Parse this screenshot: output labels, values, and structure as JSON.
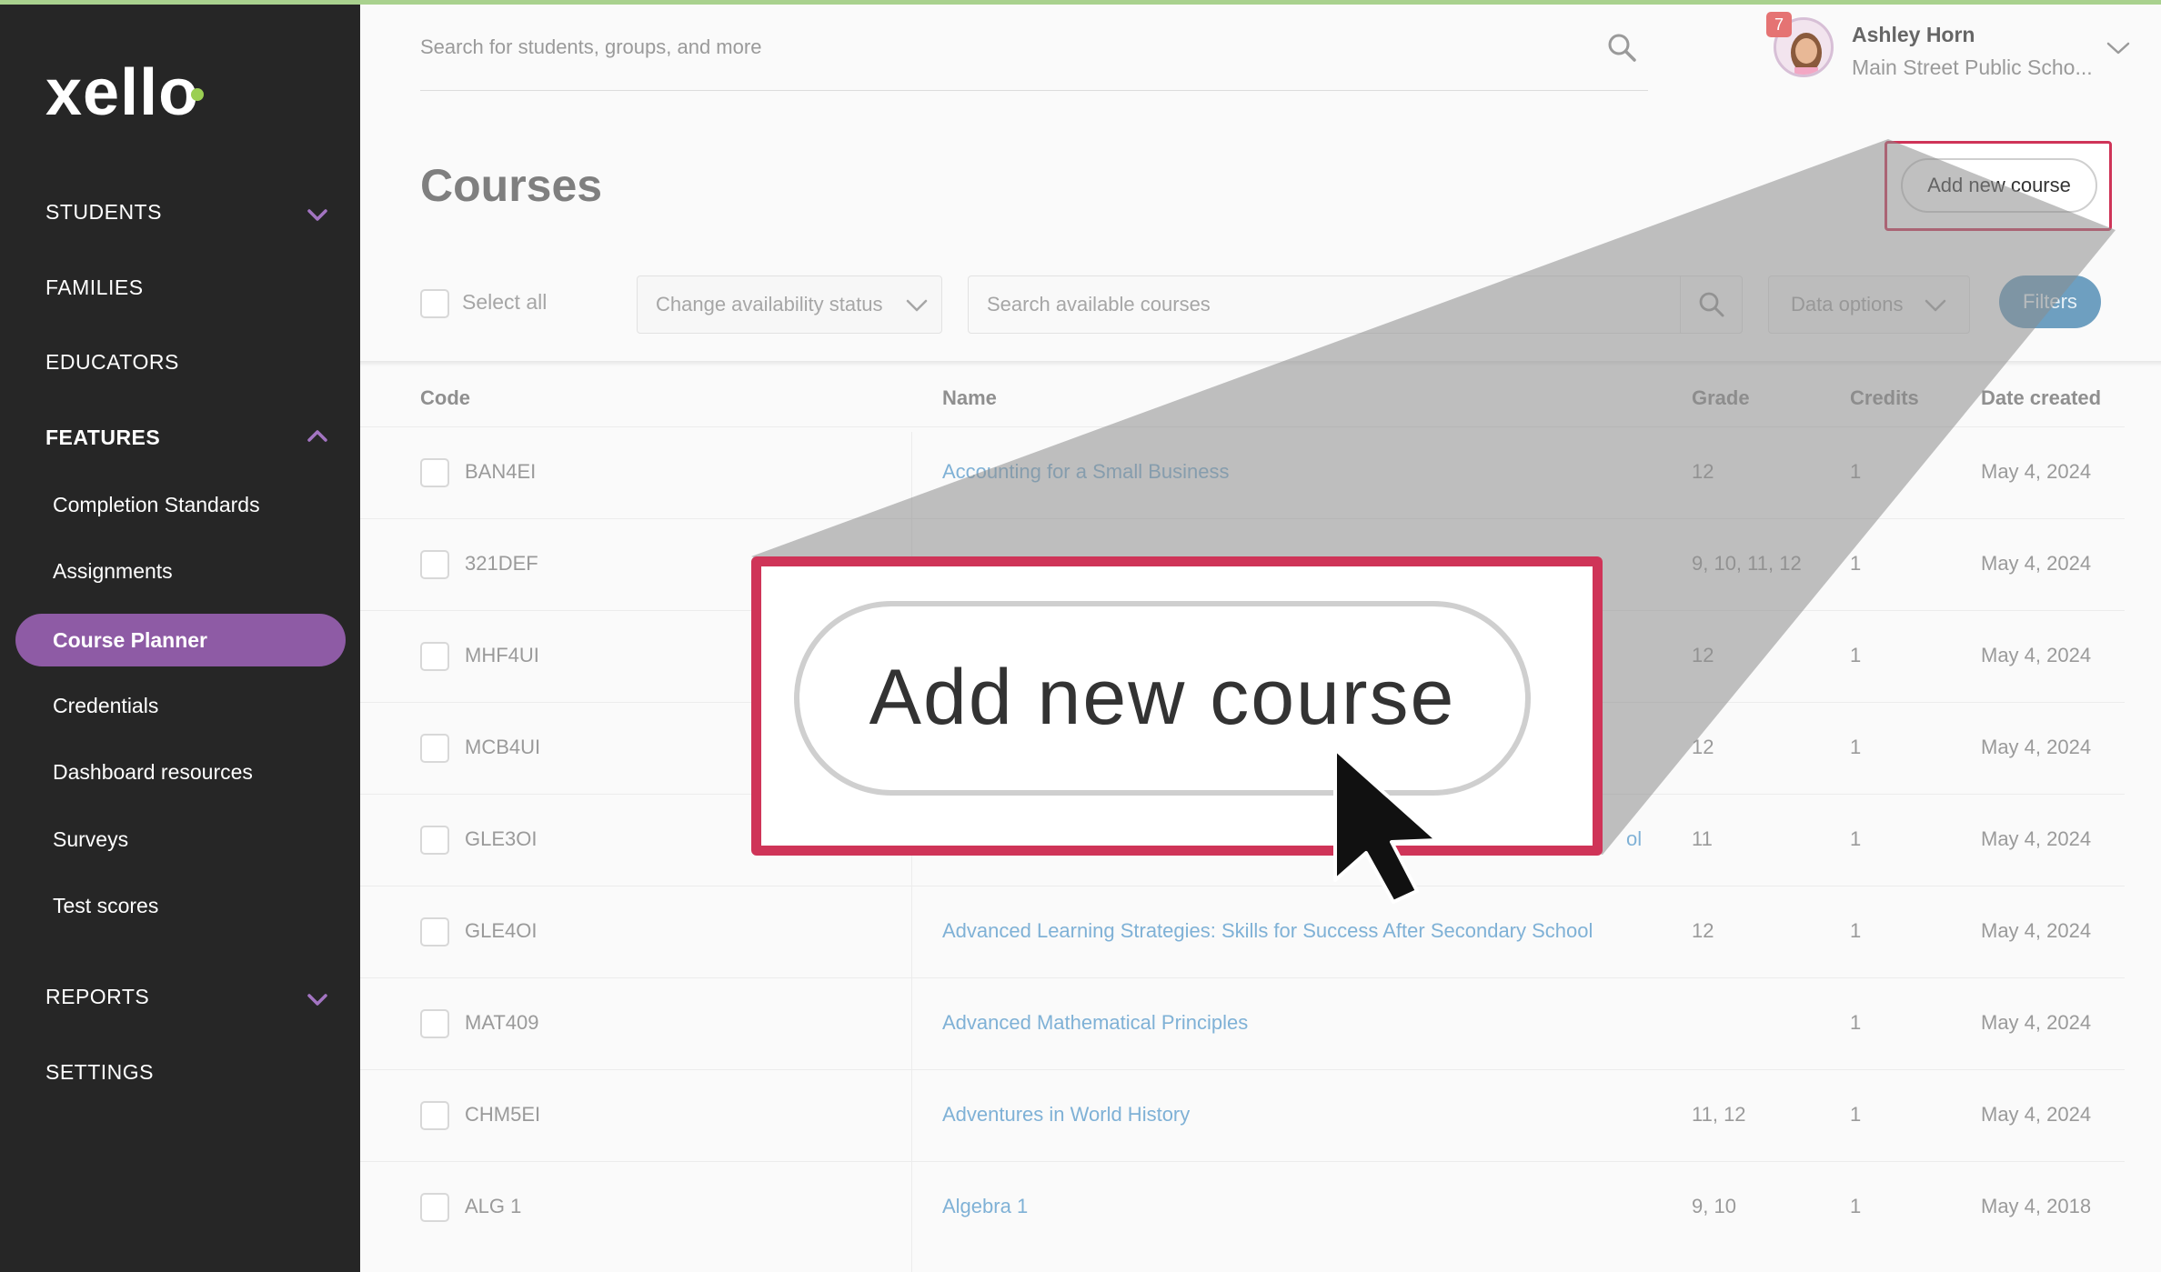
{
  "brand": {
    "logo_text": "xello",
    "accent": "#8e5ba5",
    "highlight": "#cf3458",
    "logo_dot": "#9bcf53"
  },
  "sidebar": {
    "students": "STUDENTS",
    "families": "FAMILIES",
    "educators": "EDUCATORS",
    "features": "FEATURES",
    "feature_items": [
      "Completion Standards",
      "Assignments",
      "Course Planner",
      "Credentials",
      "Dashboard resources",
      "Surveys",
      "Test scores"
    ],
    "active_item": "Course Planner",
    "reports": "REPORTS",
    "settings": "SETTINGS"
  },
  "header": {
    "search_placeholder": "Search for students, groups, and more",
    "notification_count": "7",
    "user_name": "Ashley Horn",
    "user_school": "Main Street Public Scho..."
  },
  "page": {
    "title": "Courses",
    "add_button": "Add new course"
  },
  "toolbar": {
    "select_all": "Select all",
    "availability": "Change availability status",
    "search_placeholder": "Search available courses",
    "data_options": "Data options",
    "filters": "Filters"
  },
  "table": {
    "headers": {
      "code": "Code",
      "name": "Name",
      "grade": "Grade",
      "credits": "Credits",
      "date": "Date created"
    },
    "rows": [
      {
        "code": "BAN4EI",
        "name": "Accounting for a Small Business",
        "grade": "12",
        "credits": "1",
        "date": "May 4, 2024"
      },
      {
        "code": "321DEF",
        "name": "",
        "grade": "9, 10, 11, 12",
        "credits": "1",
        "date": "May 4, 2024"
      },
      {
        "code": "MHF4UI",
        "name": "",
        "grade": "12",
        "credits": "1",
        "date": "May 4, 2024"
      },
      {
        "code": "MCB4UI",
        "name": "",
        "grade": "12",
        "credits": "1",
        "date": "May 4, 2024"
      },
      {
        "code": "GLE3OI",
        "name": "ol",
        "grade": "11",
        "credits": "1",
        "date": "May 4, 2024"
      },
      {
        "code": "GLE4OI",
        "name": "Advanced Learning Strategies: Skills for Success After Secondary School",
        "grade": "12",
        "credits": "1",
        "date": "May 4, 2024"
      },
      {
        "code": "MAT409",
        "name": "Advanced Mathematical Principles",
        "grade": "",
        "credits": "1",
        "date": "May 4, 2024"
      },
      {
        "code": "CHM5EI",
        "name": "Adventures in World History",
        "grade": "11, 12",
        "credits": "1",
        "date": "May 4, 2024"
      },
      {
        "code": "ALG 1",
        "name": "Algebra 1",
        "grade": "9, 10",
        "credits": "1",
        "date": "May 4, 2018"
      }
    ]
  },
  "zoom": {
    "label": "Add new course"
  }
}
